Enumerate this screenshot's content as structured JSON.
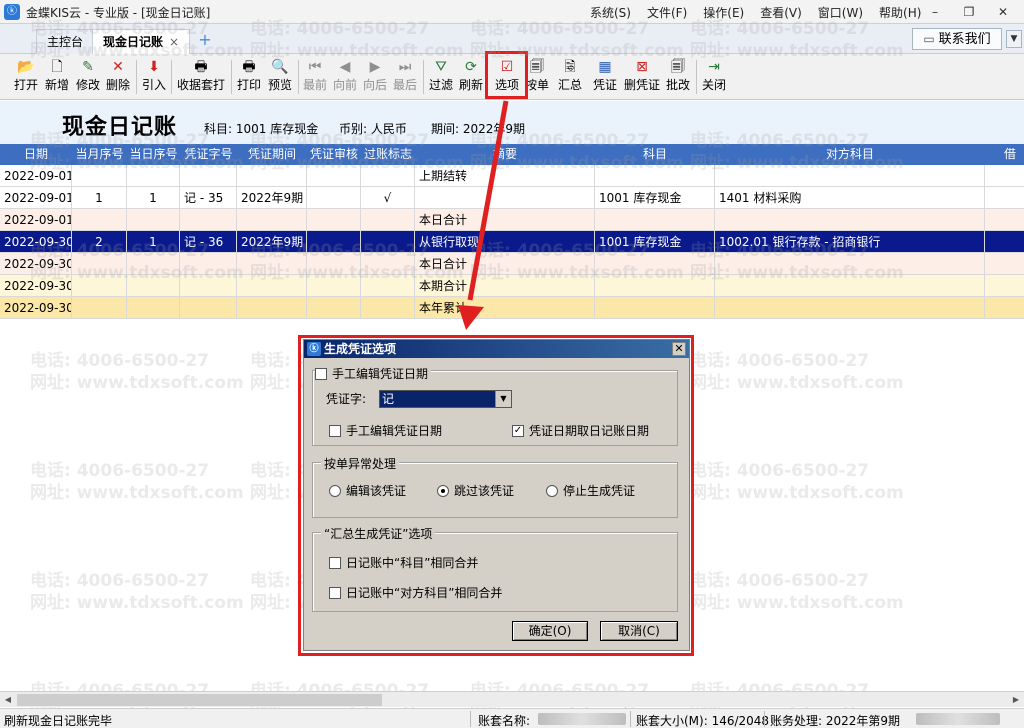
{
  "app": {
    "title": "金蝶KIS云 - 专业版 - [现金日记账]",
    "icon": "kingdee-logo-icon",
    "menu": [
      "系统(S)",
      "文件(F)",
      "操作(E)",
      "查看(V)",
      "窗口(W)",
      "帮助(H)"
    ],
    "window_controls": [
      "–",
      "❐",
      "✕"
    ]
  },
  "tabs": [
    {
      "label": "主控台"
    },
    {
      "label": "现金日记账",
      "close": "×"
    }
  ],
  "tab_add": "+",
  "contact": {
    "label": "联系我们"
  },
  "toolbar": {
    "buttons": [
      {
        "label": "打开",
        "icon": "folder-open-icon"
      },
      {
        "label": "新增",
        "icon": "new-doc-icon"
      },
      {
        "label": "修改",
        "icon": "edit-icon"
      },
      {
        "label": "删除",
        "icon": "delete-icon"
      },
      {
        "label": "引入",
        "icon": "import-icon"
      },
      {
        "label": "收据套打",
        "icon": "receipt-print-icon"
      },
      {
        "label": "打印",
        "icon": "print-icon"
      },
      {
        "label": "预览",
        "icon": "preview-icon"
      },
      {
        "label": "最前",
        "icon": "first-icon"
      },
      {
        "label": "向前",
        "icon": "prev-icon"
      },
      {
        "label": "向后",
        "icon": "next-icon"
      },
      {
        "label": "最后",
        "icon": "last-icon"
      },
      {
        "label": "过滤",
        "icon": "filter-icon"
      },
      {
        "label": "刷新",
        "icon": "refresh-icon"
      },
      {
        "label": "选项",
        "icon": "options-icon"
      },
      {
        "label": "按单",
        "icon": "by-voucher-icon"
      },
      {
        "label": "汇总",
        "icon": "summary-icon"
      },
      {
        "label": "凭证",
        "icon": "voucher-icon"
      },
      {
        "label": "删凭证",
        "icon": "delete-voucher-icon"
      },
      {
        "label": "批改",
        "icon": "batch-edit-icon"
      },
      {
        "label": "关闭",
        "icon": "exit-icon"
      }
    ]
  },
  "header": {
    "title": "现金日记账",
    "subject": "科目: 1001 库存现金",
    "currency": "币别: 人民币",
    "period": "期间: 2022年9期"
  },
  "table": {
    "columns": [
      "日期",
      "当月序号",
      "当日序号",
      "凭证字号",
      "凭证期间",
      "凭证审核",
      "过账标志",
      "摘要",
      "科目",
      "对方科目",
      "借"
    ],
    "rows": [
      {
        "date": "2022-09-01",
        "month_no": "",
        "day_no": "",
        "voucher": "",
        "period": "",
        "audit": "",
        "posted": "",
        "summary": "上期结转",
        "subject": "",
        "counter": ""
      },
      {
        "date": "2022-09-01",
        "month_no": "1",
        "day_no": "1",
        "voucher": "记 - 35",
        "period": "2022年9期",
        "audit": "",
        "posted": "√",
        "summary": "",
        "subject": "1001 库存现金",
        "counter": "1401 材料采购"
      },
      {
        "date": "2022-09-01",
        "month_no": "",
        "day_no": "",
        "voucher": "",
        "period": "",
        "audit": "",
        "posted": "",
        "summary": "本日合计",
        "subject": "",
        "counter": ""
      },
      {
        "date": "2022-09-30",
        "month_no": "2",
        "day_no": "1",
        "voucher": "记 - 36",
        "period": "2022年9期",
        "audit": "",
        "posted": "",
        "summary": "从银行取现",
        "subject": "1001 库存现金",
        "counter": "1002.01 银行存款 - 招商银行"
      },
      {
        "date": "2022-09-30",
        "month_no": "",
        "day_no": "",
        "voucher": "",
        "period": "",
        "audit": "",
        "posted": "",
        "summary": "本日合计",
        "subject": "",
        "counter": ""
      },
      {
        "date": "2022-09-30",
        "month_no": "",
        "day_no": "",
        "voucher": "",
        "period": "",
        "audit": "",
        "posted": "",
        "summary": "本期合计",
        "subject": "",
        "counter": ""
      },
      {
        "date": "2022-09-30",
        "month_no": "",
        "day_no": "",
        "voucher": "",
        "period": "",
        "audit": "",
        "posted": "",
        "summary": "本年累计",
        "subject": "",
        "counter": ""
      }
    ]
  },
  "watermark": {
    "phone": "电话: 4006-6500-27",
    "site": "网址: www.tdxsoft.com"
  },
  "dialog": {
    "title": "生成凭证选项",
    "close": "✕",
    "manual_edit_top": {
      "label": "手工编辑凭证日期",
      "checked": false
    },
    "voucher_word_label": "凭证字:",
    "voucher_word_value": "记",
    "manual_edit_date": {
      "label": "手工编辑凭证日期",
      "checked": false
    },
    "use_journal_date": {
      "label": "凭证日期取日记账日期",
      "checked": true
    },
    "exception_group": "按单异常处理",
    "exception_options": [
      {
        "label": "编辑该凭证",
        "selected": false
      },
      {
        "label": "跳过该凭证",
        "selected": true
      },
      {
        "label": "停止生成凭证",
        "selected": false
      }
    ],
    "summary_group": "“汇总生成凭证”选项",
    "merge_subject": {
      "label": "日记账中“科目”相同合并",
      "checked": false
    },
    "merge_counter": {
      "label": "日记账中“对方科目”相同合并",
      "checked": false
    },
    "ok": "确定(O)",
    "cancel": "取消(C)"
  },
  "status": {
    "message": "刷新现金日记账完毕",
    "account_name_label": "账套名称:",
    "account_size": "账套大小(M): 146/2048",
    "processing": "账务处理: 2022年第9期"
  },
  "colors": {
    "accent": "#3d6ebf",
    "selected_row": "#0a1a8c",
    "annotation_red": "#e02020",
    "row_pink": "#fdeee8",
    "row_cream": "#fdf6d8",
    "row_yellow": "#fbe7a8"
  }
}
